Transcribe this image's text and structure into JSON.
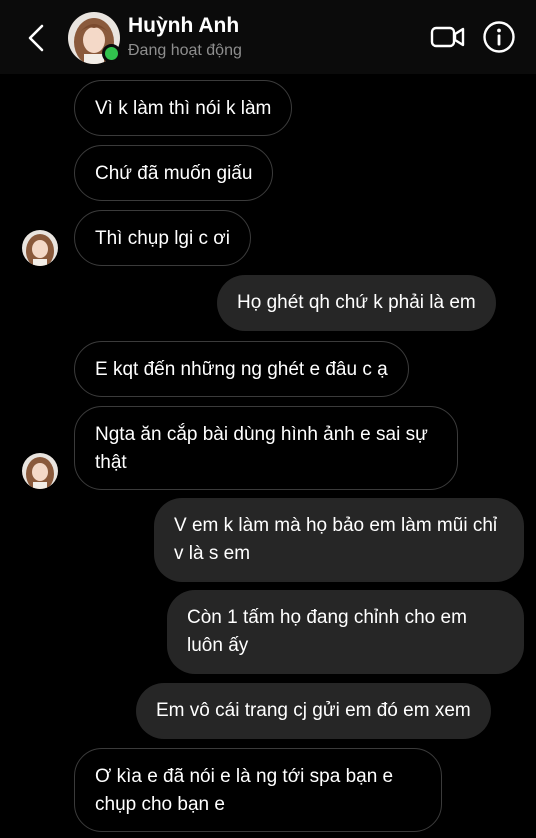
{
  "header": {
    "name": "Huỳnh Anh",
    "status": "Đang hoạt động",
    "back_icon": "chevron-left-icon",
    "video_icon": "video-call-icon",
    "info_icon": "info-icon"
  },
  "messages": [
    {
      "side": "in",
      "text": "Vì k làm thì nói k làm"
    },
    {
      "side": "in",
      "text": "Chứ đã muốn giấu"
    },
    {
      "side": "in",
      "text": "Thì chụp lgi c ơi"
    },
    {
      "side": "out",
      "text": "Họ ghét qh chứ k phải là em"
    },
    {
      "side": "in",
      "text": "E kqt đến những ng ghét e đâu c ạ"
    },
    {
      "side": "in",
      "text": "Ngta ăn cắp bài dùng hình ảnh e sai sự thật"
    },
    {
      "side": "out",
      "text": "V em k làm mà họ bảo em làm mũi chỉ v là s em"
    },
    {
      "side": "out",
      "text": "Còn 1 tấm họ đang chỉnh cho em luôn ấy"
    },
    {
      "side": "out",
      "text": "Em vô cái trang cj gửi em đó em xem"
    },
    {
      "side": "in",
      "text": "Ơ kìa e đã nói e là ng tới spa bạn e chụp cho bạn e"
    }
  ],
  "colors": {
    "background": "#000000",
    "incoming_border": "#3b3b3b",
    "outgoing_bg": "#262626",
    "online": "#31c24d"
  }
}
